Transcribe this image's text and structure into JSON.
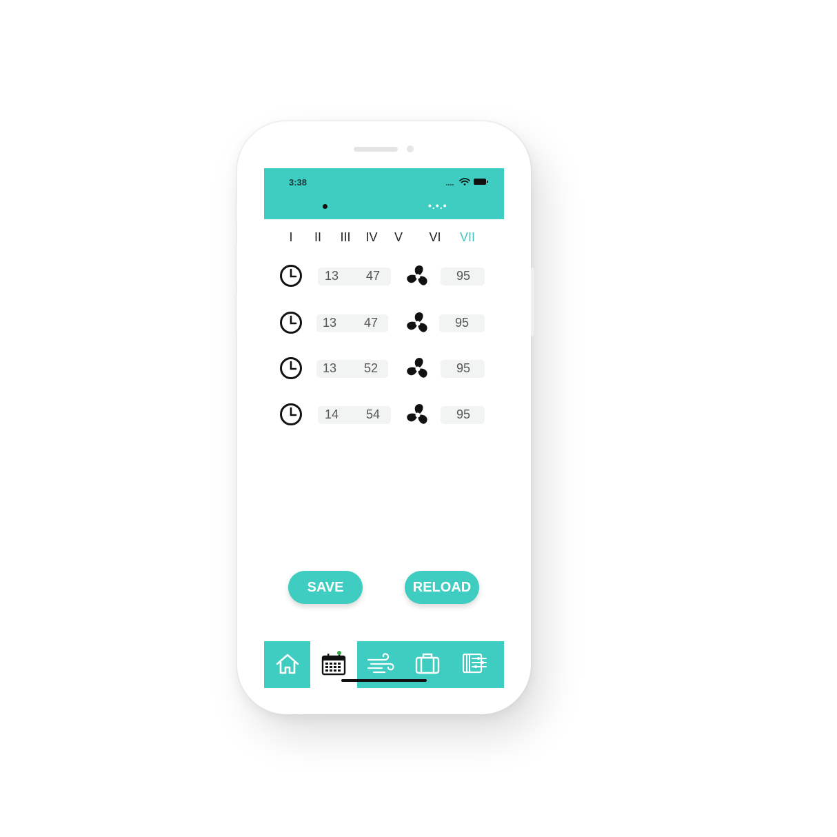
{
  "status_bar": {
    "time": "3:38"
  },
  "header": {
    "page_indicator": "•",
    "more_label": "•.•.•"
  },
  "days": [
    {
      "label": "I",
      "active": false
    },
    {
      "label": "II",
      "active": false
    },
    {
      "label": "III",
      "active": false
    },
    {
      "label": "IV",
      "active": false
    },
    {
      "label": "V",
      "active": false
    },
    {
      "label": "VI",
      "active": false
    },
    {
      "label": "VII",
      "active": true
    }
  ],
  "schedule": [
    {
      "hour": "13",
      "minute": "47",
      "fan_speed": "95"
    },
    {
      "hour": "13",
      "minute": "47",
      "fan_speed": "95"
    },
    {
      "hour": "13",
      "minute": "52",
      "fan_speed": "95"
    },
    {
      "hour": "14",
      "minute": "54",
      "fan_speed": "95"
    }
  ],
  "actions": {
    "save_label": "SAVE",
    "reload_label": "RELOAD"
  },
  "tabs": [
    {
      "icon": "home-icon",
      "active": false
    },
    {
      "icon": "calendar-icon",
      "active": true
    },
    {
      "icon": "wind-icon",
      "active": false
    },
    {
      "icon": "suitcase-icon",
      "active": false
    },
    {
      "icon": "settings-panel-icon",
      "active": false
    }
  ],
  "colors": {
    "accent": "#3ecdc0",
    "active_day": "#40c8c0",
    "pill": "#f2f3f3"
  }
}
